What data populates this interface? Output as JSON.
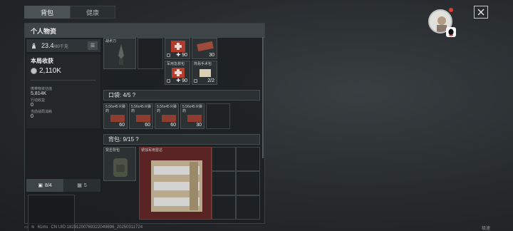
{
  "tabs": [
    {
      "label": "背包"
    },
    {
      "label": "健康"
    }
  ],
  "panel": {
    "title": "个人物资"
  },
  "weight": {
    "value": "23.4",
    "unit": "/80千克"
  },
  "stats": {
    "title": "本局收获",
    "total": "2,110K",
    "carried_label": "携带物资估值",
    "carried_value": "5,814K",
    "action_label": "行动收益",
    "action_value": "0",
    "consumption_label": "当前战局消耗",
    "consumption_value": "0"
  },
  "left_tabs": [
    {
      "label": "8/4"
    },
    {
      "label": "5"
    }
  ],
  "upper_items": [
    {
      "name": "战术刀",
      "count": ""
    },
    {
      "name": "",
      "count": "90"
    },
    {
      "name": "",
      "count": "30"
    },
    {
      "name": "军用急救包",
      "count": "90"
    },
    {
      "name": "简易手术包",
      "count": "2/2"
    }
  ],
  "pocket": {
    "label": "口袋: 4/5 ?",
    "items": [
      {
        "name": "5.56x45 R弹药",
        "count": "60"
      },
      {
        "name": "5.56x45 R弹药",
        "count": "60"
      },
      {
        "name": "5.56x45 R弹药",
        "count": "60"
      },
      {
        "name": "5.56x45 R弹药",
        "count": "30"
      }
    ]
  },
  "backpack": {
    "label": "背包: 9/15 ?",
    "items": [
      {
        "name": "突击背包"
      },
      {
        "name": "锈蚀军用雷达"
      }
    ]
  },
  "status_bar": {
    "ping": "61ms",
    "uid": "CN UID:1829120076932204989​6_2025031​1724"
  },
  "fullscreen_label": "极速",
  "colors": {
    "rare_red": "#7a2a2a",
    "panel_bg": "#1c1f21",
    "accent_red": "#e23a2e"
  }
}
